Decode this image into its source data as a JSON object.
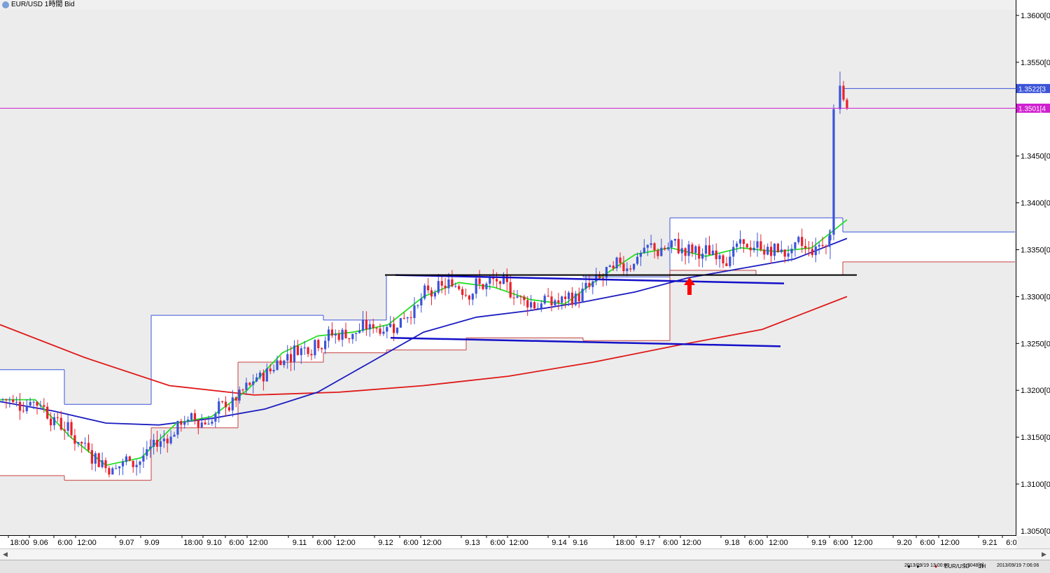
{
  "window": {
    "title": "EUR/USD 1時間 Bid"
  },
  "toolbar": {
    "symbol": "EUR/USD",
    "timeframe": "1H",
    "status_time": "2013/09/19 13:00:00",
    "status_price": "1.3048[8]",
    "status_clock": "2013/09/19 7:06:06"
  },
  "colors": {
    "candle_up": "#3b54d8",
    "candle_down": "#e8202a",
    "ma_short": "#22e022",
    "ma_mid": "#1c1cc0",
    "ma_long": "#e01818",
    "current_price_line": "#d020d0",
    "trendline_blue": "#1410c8",
    "horizontal_line": "#000000",
    "arrow": "#ff0000"
  },
  "chart_data": {
    "type": "candlestick",
    "title": "EUR/USD 1時間 Bid",
    "ylim": [
      1.305,
      1.36
    ],
    "y_ticks": [
      "1.3600[0",
      "1.3550[0",
      "1.3450[0",
      "1.3400[0",
      "1.3350[0",
      "1.3300[0",
      "1.3250[0",
      "1.3200[0",
      "1.3150[0",
      "1.3100[0",
      "1.3050[0"
    ],
    "price_labels": [
      {
        "label": "1.3522[3",
        "value": 1.3522,
        "color": "#3b54d8"
      },
      {
        "label": "1.3501[4",
        "value": 1.3501,
        "color": "#d020d0"
      }
    ],
    "x_ticks": [
      "18:00",
      "9.06",
      "6:00",
      "12:00",
      "9.07",
      "9.09",
      "18:00",
      "9.10",
      "6:00",
      "12:00",
      "9.11",
      "6:00",
      "12:00",
      "9.12",
      "6:00",
      "12:00",
      "9.13",
      "6:00",
      "12:00",
      "9.14",
      "9.16",
      "18:00",
      "9.17",
      "6:00",
      "12:00",
      "9.18",
      "6:00",
      "12:00",
      "9.19",
      "6:00",
      "12:00",
      "9.20",
      "6:00",
      "12:00",
      "9.21",
      "6:00"
    ],
    "day_ranges": [
      {
        "high": 1.3222,
        "low": 1.3109
      },
      {
        "high": 1.3185,
        "low": 1.3104
      },
      {
        "high": 1.328,
        "low": 1.316
      },
      {
        "high": 1.328,
        "low": 1.323
      },
      {
        "high": 1.3275,
        "low": 1.324
      },
      {
        "high": 1.3323,
        "low": 1.3243
      },
      {
        "high": 1.3323,
        "low": 1.3256
      },
      {
        "high": 1.3321,
        "low": 1.3253
      },
      {
        "high": 1.3384,
        "low": 1.3328
      },
      {
        "high": 1.3384,
        "low": 1.3323
      },
      {
        "high": 1.3369,
        "low": 1.3337
      },
      {
        "high": 1.3542,
        "low": 1.3337
      },
      {
        "high": 1.3522,
        "low": 1.3501
      }
    ],
    "ma_short": [
      1.319,
      1.319,
      1.315,
      1.312,
      1.3128,
      1.3165,
      1.3172,
      1.32,
      1.324,
      1.3258,
      1.3262,
      1.327,
      1.33,
      1.3315,
      1.331,
      1.3297,
      1.3292,
      1.332,
      1.3345,
      1.3352,
      1.3343,
      1.3352,
      1.3348,
      1.3352,
      1.3382
    ],
    "ma_mid": [
      1.3188,
      1.3178,
      1.3165,
      1.3163,
      1.317,
      1.318,
      1.3198,
      1.323,
      1.3262,
      1.3278,
      1.3285,
      1.3294,
      1.3305,
      1.332,
      1.333,
      1.334,
      1.3362
    ],
    "ma_long": [
      1.327,
      1.3235,
      1.3205,
      1.3195,
      1.3198,
      1.3205,
      1.3215,
      1.323,
      1.3248,
      1.3265,
      1.33
    ],
    "current_price": 1.3501,
    "horizontal_level": 1.3323,
    "trendlines": [
      {
        "from": 1.3323,
        "to": 1.3314
      },
      {
        "from": 1.3256,
        "to": 1.3247
      }
    ]
  }
}
